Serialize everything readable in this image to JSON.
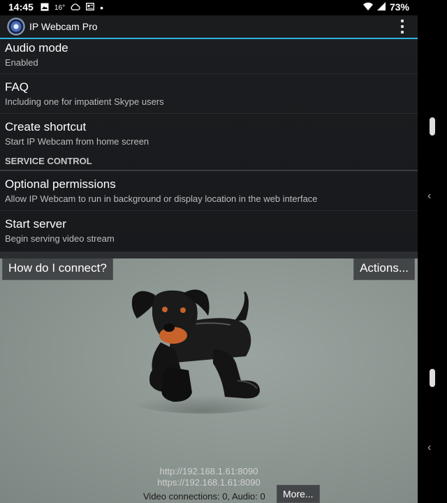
{
  "status_bar": {
    "time": "14:45",
    "temp": "16°",
    "battery": "73%",
    "icons": [
      "image-icon",
      "cloud-icon",
      "news-icon",
      "dot-icon",
      "wifi-icon",
      "signal-icon"
    ]
  },
  "app_bar": {
    "title": "IP Webcam Pro"
  },
  "settings": {
    "audio": {
      "title": "Audio mode",
      "summary": "Enabled"
    },
    "faq": {
      "title": "FAQ",
      "summary": "Including one for impatient Skype users"
    },
    "shortcut": {
      "title": "Create shortcut",
      "summary": "Start IP Webcam from home screen"
    },
    "category": "SERVICE CONTROL",
    "permissions": {
      "title": "Optional permissions",
      "summary": "Allow IP Webcam to run in background or display location in the web interface"
    },
    "server": {
      "title": "Start server",
      "summary": "Begin serving video stream"
    }
  },
  "camera": {
    "connect_label": "How do I connect?",
    "actions_label": "Actions...",
    "http_url": "http://192.168.1.61:8090",
    "https_url": "https://192.168.1.61:8090",
    "connections": "Video connections: 0, Audio: 0",
    "more_label": "More..."
  },
  "colors": {
    "accent": "#33b5e5",
    "background": "#1b1d20"
  }
}
